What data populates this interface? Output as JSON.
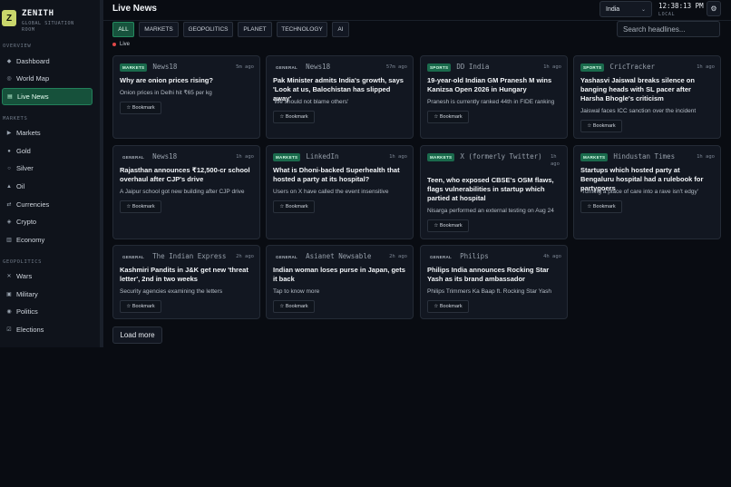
{
  "brand": {
    "logo_letter": "Z",
    "name": "ZENITH",
    "subtitle": "GLOBAL SITUATION ROOM"
  },
  "sidebar": {
    "overview_label": "OVERVIEW",
    "markets_label": "MARKETS",
    "geopolitics_label": "GEOPOLITICS",
    "items": [
      {
        "label": "Dashboard",
        "icon": "dashboard-icon",
        "glyph": "◆"
      },
      {
        "label": "World Map",
        "icon": "globe-icon",
        "glyph": "◎"
      },
      {
        "label": "Live News",
        "icon": "news-icon",
        "glyph": "▤"
      },
      {
        "label": "Markets",
        "icon": "chart-icon",
        "glyph": "▶"
      },
      {
        "label": "Gold",
        "icon": "gold-icon",
        "glyph": "●"
      },
      {
        "label": "Silver",
        "icon": "silver-icon",
        "glyph": "○"
      },
      {
        "label": "Oil",
        "icon": "oil-icon",
        "glyph": "▲"
      },
      {
        "label": "Currencies",
        "icon": "currency-icon",
        "glyph": "⇄"
      },
      {
        "label": "Crypto",
        "icon": "crypto-icon",
        "glyph": "◈"
      },
      {
        "label": "Economy",
        "icon": "economy-icon",
        "glyph": "▥"
      },
      {
        "label": "Wars",
        "icon": "swords-icon",
        "glyph": "✕"
      },
      {
        "label": "Military",
        "icon": "shield-icon",
        "glyph": "▣"
      },
      {
        "label": "Politics",
        "icon": "politics-icon",
        "glyph": "◉"
      },
      {
        "label": "Elections",
        "icon": "ballot-icon",
        "glyph": "☑"
      }
    ]
  },
  "header": {
    "title": "Live News",
    "country": "India",
    "time": "12:38:13 PM",
    "zone": "LOCAL"
  },
  "tabs": [
    "ALL",
    "MARKETS",
    "GEOPOLITICS",
    "PLANET",
    "TECHNOLOGY",
    "AI"
  ],
  "search": {
    "placeholder": "Search headlines..."
  },
  "live_label": "Live",
  "bookmark_label": "☆ Bookmark",
  "load_more": "Load more",
  "cards": [
    {
      "category": "MARKETS",
      "source": "News18",
      "time": "5m ago",
      "headline": "Why are onion prices rising?",
      "summary": "Onion prices in Delhi hit ₹65 per kg"
    },
    {
      "category": "GENERAL",
      "source": "News18",
      "time": "57m ago",
      "headline": "Pak Minister admits India's growth, says 'Look at us, Balochistan has slipped away'",
      "summary": "'We should not blame others'"
    },
    {
      "category": "SPORTS",
      "source": "DD India",
      "time": "1h ago",
      "headline": "19-year-old Indian GM Pranesh M wins Kanizsa Open 2026 in Hungary",
      "summary": "Pranesh is currently ranked 44th in FIDE ranking"
    },
    {
      "category": "SPORTS",
      "source": "CricTracker",
      "time": "1h ago",
      "headline": "Yashasvi Jaiswal breaks silence on banging heads with SL pacer after Harsha Bhogle's criticism",
      "summary": "Jaiswal faces ICC sanction over the incident"
    },
    {
      "category": "GENERAL",
      "source": "News18",
      "time": "1h ago",
      "headline": "Rajasthan announces ₹12,500-cr school overhaul after CJP's drive",
      "summary": "A Jaipur school got new building after CJP drive"
    },
    {
      "category": "MARKETS",
      "source": "LinkedIn",
      "time": "1h ago",
      "headline": "What is Dhoni-backed Superhealth that hosted a party at its hospital?",
      "summary": "Users on X have called the event insensitive"
    },
    {
      "category": "MARKETS",
      "source": "X (formerly Twitter)",
      "time": "1h ago",
      "headline": "Teen, who exposed CBSE's OSM flaws, flags vulnerabilities in startup which partied at hospital",
      "summary": "Nisarga performed an external testing on Aug 24"
    },
    {
      "category": "MARKETS",
      "source": "Hindustan Times",
      "time": "1h ago",
      "headline": "Startups which hosted party at Bengaluru hospital had a rulebook for partygoers",
      "summary": "'Turning a place of care into a rave isn't edgy'"
    },
    {
      "category": "GENERAL",
      "source": "The Indian Express",
      "time": "2h ago",
      "headline": "Kashmiri Pandits in J&K get new 'threat letter', 2nd in two weeks",
      "summary": "Security agencies examining the letters"
    },
    {
      "category": "GENERAL",
      "source": "Asianet Newsable",
      "time": "2h ago",
      "headline": "Indian woman loses purse in Japan, gets it back",
      "summary": "Tap to know more"
    },
    {
      "category": "GENERAL",
      "source": "Philips",
      "time": "4h ago",
      "headline": "Philips India announces Rocking Star Yash as its brand ambassador",
      "summary": "Philips Trimmers Ka Baap ft. Rocking Star Yash"
    }
  ],
  "colors": {
    "accent": "#17533d",
    "accent_border": "#238a5f",
    "live_dot": "#e04848",
    "background": "#090c12",
    "card": "#121721"
  }
}
